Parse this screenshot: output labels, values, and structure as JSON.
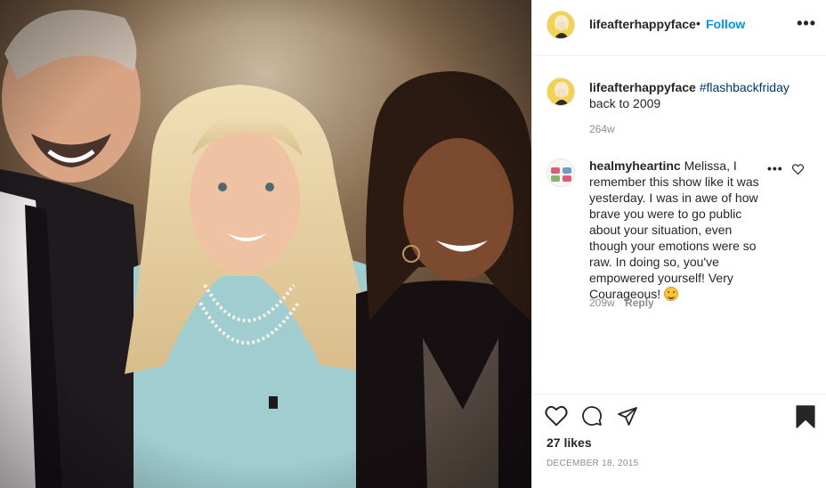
{
  "post": {
    "image_alt": "Photo of three people smiling together",
    "username": "lifeafterhappyface",
    "follow_label": "Follow",
    "header_separator": "•",
    "more_icon": "more-horizontal-icon"
  },
  "caption": {
    "username": "lifeafterhappyface",
    "hashtag": "#flashbackfriday",
    "text": "back to 2009",
    "time": "264w"
  },
  "comments": [
    {
      "username": "healmyheartinc",
      "text": "Melissa, I remember this show like it was yesterday. I was in awe of how brave you were to go public about your situation, even though your emotions were so raw. In doing so, you've empowered yourself! Very Courageous!",
      "emoji": "smiling-face-icon",
      "time": "209w",
      "reply_label": "Reply"
    }
  ],
  "actions": {
    "like_icon": "heart-icon",
    "comment_icon": "comment-icon",
    "share_icon": "share-icon",
    "save_icon": "bookmark-icon"
  },
  "likes": "27 likes",
  "date": "DECEMBER 18, 2015",
  "colors": {
    "link_blue": "#0095f6",
    "hashtag": "#00376b",
    "muted": "#8e8e8e",
    "text": "#262626",
    "border": "#efefef"
  }
}
